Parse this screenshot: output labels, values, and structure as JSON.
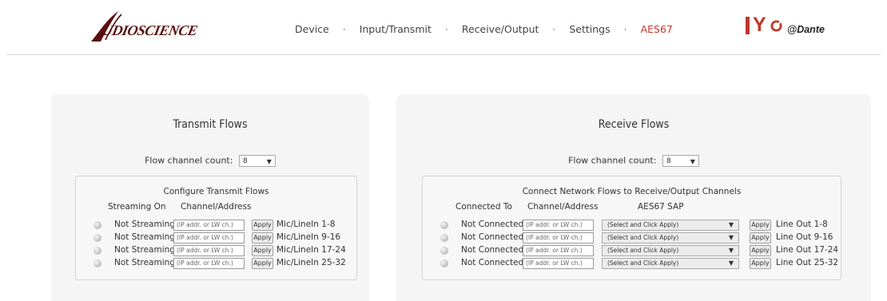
{
  "header": {
    "logo_text": "UDIOSCIENCE",
    "nav": [
      {
        "label": "Device",
        "active": false
      },
      {
        "label": "Input/Transmit",
        "active": false
      },
      {
        "label": "Receive/Output",
        "active": false
      },
      {
        "label": "Settings",
        "active": false
      },
      {
        "label": "AES67",
        "active": true
      }
    ],
    "nav_separator": "·",
    "brand_iyo_y": "Y",
    "brand_dante": "Dante"
  },
  "colors": {
    "accent": "#c0392b",
    "logo": "#5a0f0f"
  },
  "transmit": {
    "title": "Transmit Flows",
    "count_label": "Flow channel count:",
    "count_value": "8",
    "box_title": "Configure Transmit Flows",
    "col_streaming": "Streaming On",
    "col_address": "Channel/Address",
    "rows": [
      {
        "status": "Not Streaming",
        "address_placeholder": "(IP addr. or LW ch.)",
        "apply": "Apply",
        "channel": "Mic/LineIn 1-8"
      },
      {
        "status": "Not Streaming",
        "address_placeholder": "(IP addr. or LW ch.)",
        "apply": "Apply",
        "channel": "Mic/LineIn 9-16"
      },
      {
        "status": "Not Streaming",
        "address_placeholder": "(IP addr. or LW ch.)",
        "apply": "Apply",
        "channel": "Mic/LineIn 17-24"
      },
      {
        "status": "Not Streaming",
        "address_placeholder": "(IP addr. or LW ch.)",
        "apply": "Apply",
        "channel": "Mic/LineIn 25-32"
      }
    ]
  },
  "receive": {
    "title": "Receive Flows",
    "count_label": "Flow channel count:",
    "count_value": "8",
    "box_title": "Connect Network Flows to Receive/Output Channels",
    "col_connected": "Connected To",
    "col_address": "Channel/Address",
    "col_sap": "AES67 SAP",
    "rows": [
      {
        "status": "Not Connected",
        "address_placeholder": "(IP addr. or LW ch.)",
        "sap": "(Select and Click Apply)",
        "apply": "Apply",
        "channel": "Line Out 1-8"
      },
      {
        "status": "Not Connected",
        "address_placeholder": "(IP addr. or LW ch.)",
        "sap": "(Select and Click Apply)",
        "apply": "Apply",
        "channel": "Line Out 9-16"
      },
      {
        "status": "Not Connected",
        "address_placeholder": "(IP addr. or LW ch.)",
        "sap": "(Select and Click Apply)",
        "apply": "Apply",
        "channel": "Line Out 17-24"
      },
      {
        "status": "Not Connected",
        "address_placeholder": "(IP addr. or LW ch.)",
        "sap": "(Select and Click Apply)",
        "apply": "Apply",
        "channel": "Line Out 25-32"
      }
    ]
  }
}
